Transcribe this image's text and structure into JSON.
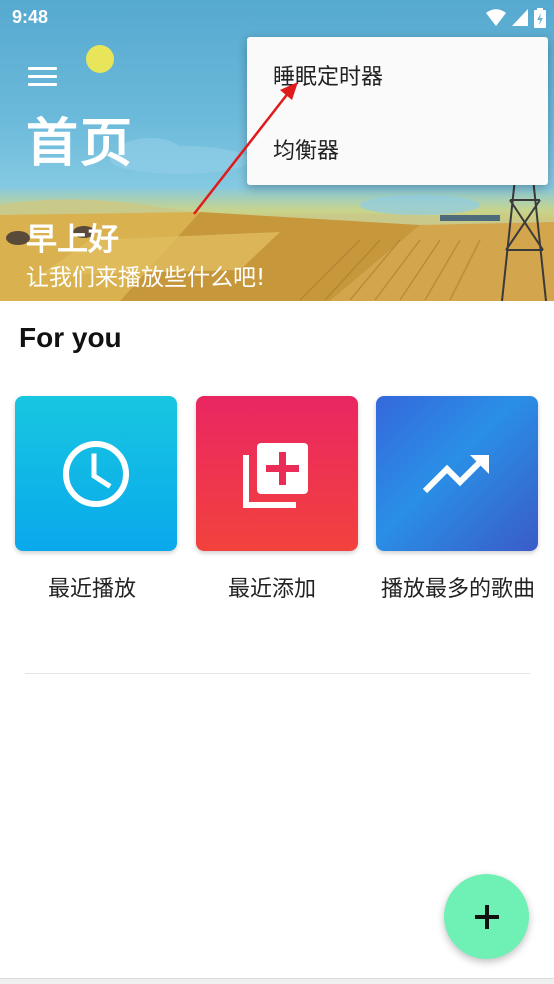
{
  "status_bar": {
    "time": "9:48"
  },
  "header": {
    "title": "首页",
    "greeting": "早上好",
    "subtitle": "让我们来播放些什么吧!"
  },
  "popup_menu": {
    "items": [
      {
        "label": "睡眠定时器"
      },
      {
        "label": "均衡器"
      }
    ]
  },
  "section": {
    "title": "For you",
    "cards": [
      {
        "label": "最近播放",
        "icon": "clock-icon",
        "color": "#09a9ec"
      },
      {
        "label": "最近添加",
        "icon": "add-to-queue-icon",
        "color": "#ea2662"
      },
      {
        "label": "播放最多的歌曲",
        "icon": "trending-up-icon",
        "color": "#3568dc"
      }
    ]
  },
  "fab": {
    "icon": "plus-icon",
    "color": "#6ff0b5"
  }
}
